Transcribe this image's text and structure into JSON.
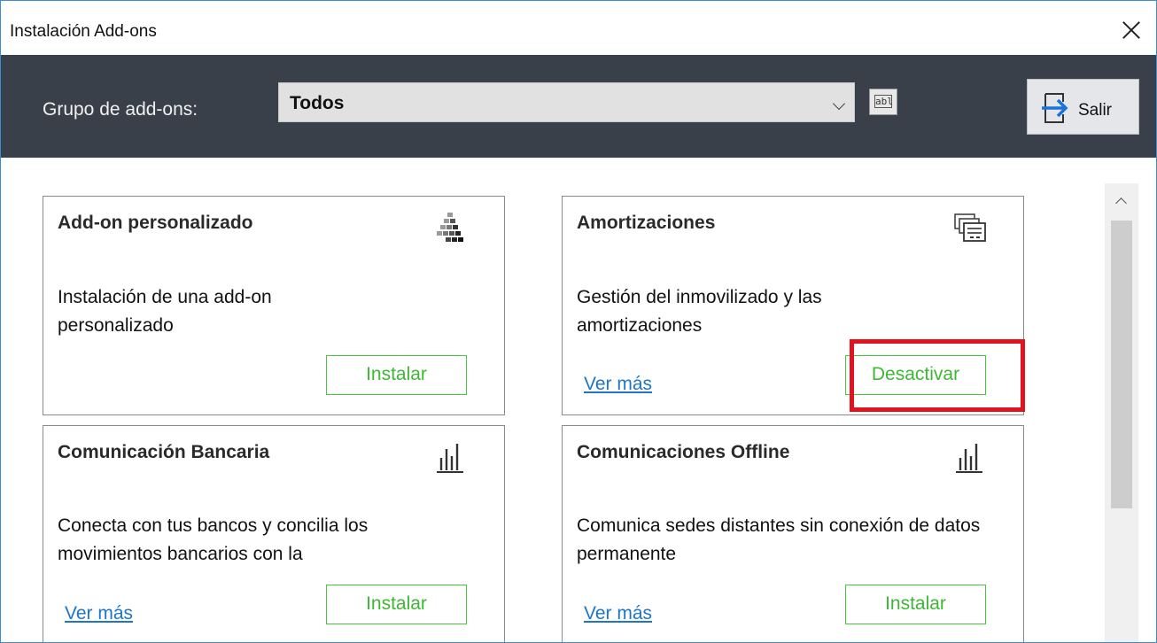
{
  "window": {
    "title": "Instalación Add-ons",
    "close_icon": "close-icon"
  },
  "toolbar": {
    "group_label": "Grupo de add-ons:",
    "group_selected": "Todos",
    "abl_icon_text": "abl",
    "exit_label": "Salir"
  },
  "cards": [
    {
      "title": "Add-on personalizado",
      "description": "Instalación de una add-on personalizado",
      "link": "",
      "button": "Instalar",
      "icon": "puzzle-blocks-icon"
    },
    {
      "title": "Amortizaciones",
      "description": "Gestión del inmovilizado y las amortizaciones",
      "link": "Ver más",
      "button": "Desactivar",
      "icon": "stacked-documents-icon",
      "highlighted": true
    },
    {
      "title": "Comunicación Bancaria",
      "description": "Conecta con tus bancos y concilia los movimientos bancarios con la",
      "link": "Ver más",
      "button": "Instalar",
      "icon": "bar-chart-icon"
    },
    {
      "title": "Comunicaciones Offline",
      "description": "Comunica sedes distantes sin conexión de datos permanente",
      "link": "Ver más",
      "button": "Instalar",
      "icon": "bar-chart-icon"
    }
  ],
  "colors": {
    "accent_green": "#46c83c",
    "highlight_red": "#e0131e",
    "toolbar_bg": "#3a404a",
    "link_blue": "#1f75c9"
  }
}
